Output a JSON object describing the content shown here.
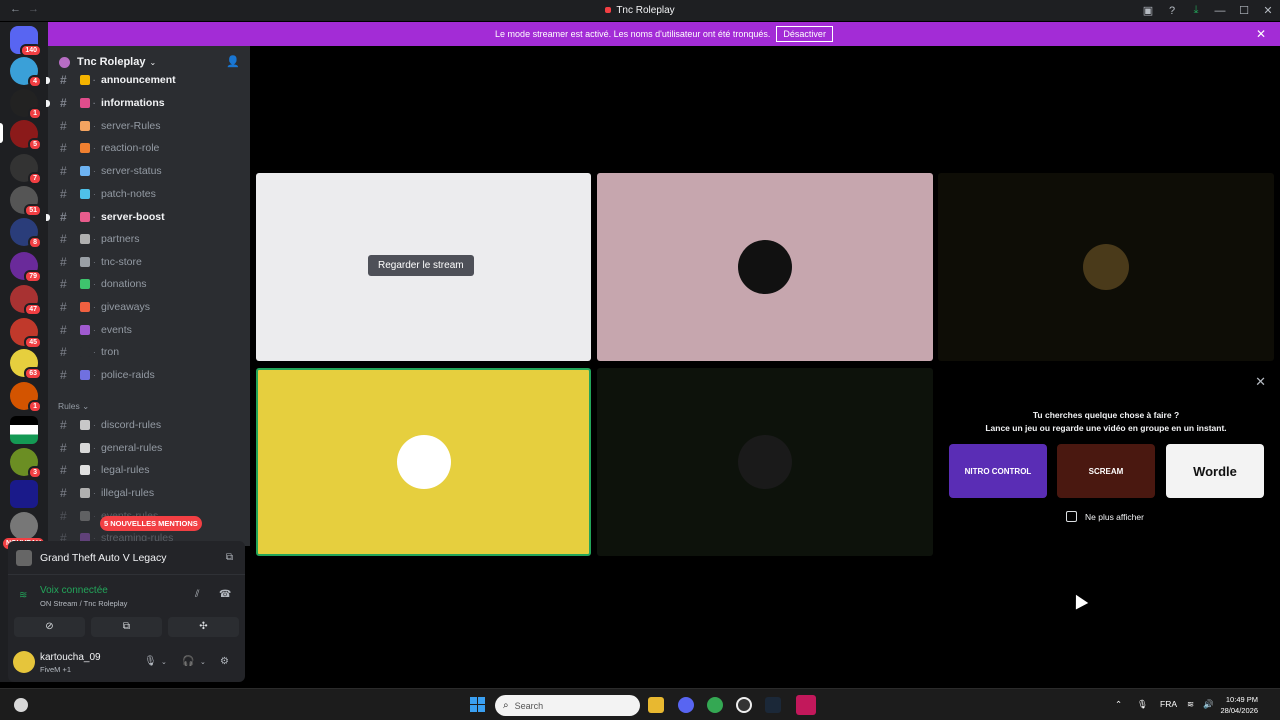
{
  "titlebar": {
    "title": "Tnc Roleplay",
    "back_icon": "←",
    "forward_icon": "→",
    "icons": [
      "inbox-icon",
      "help-icon",
      "download-icon",
      "minimize-icon",
      "maximize-icon",
      "close-icon"
    ]
  },
  "banner": {
    "text": "Le mode streamer est activé. Les noms d'utilisateur ont été tronqués.",
    "button": "Désactiver",
    "color": "#a32cd6"
  },
  "servers": {
    "badges": [
      "140",
      "4",
      "1",
      "5",
      "7",
      "51",
      "8",
      "79",
      "47",
      "45",
      "63",
      "1",
      "3",
      "",
      ""
    ],
    "new_label": "NOUVEAU"
  },
  "guild": {
    "name": "Tnc Roleplay",
    "channels": [
      {
        "name": "announcement",
        "emoji_color": "#f4b400",
        "bright": true
      },
      {
        "name": "informations",
        "emoji_color": "#e04d8c",
        "bright": true
      },
      {
        "name": "server-Rules",
        "emoji_color": "#f4a460",
        "bright": false
      },
      {
        "name": "reaction-role",
        "emoji_color": "#f08030",
        "bright": false
      },
      {
        "name": "server-status",
        "emoji_color": "#6db3f2",
        "bright": false
      },
      {
        "name": "patch-notes",
        "emoji_color": "#4fc1e9",
        "bright": false
      },
      {
        "name": "server-boost",
        "emoji_color": "#e85c8c",
        "bright": true
      },
      {
        "name": "partners",
        "emoji_color": "#b0b0b0",
        "bright": false
      },
      {
        "name": "tnc-store",
        "emoji_color": "#9aa0a6",
        "bright": false
      },
      {
        "name": "donations",
        "emoji_color": "#3ec46d",
        "bright": false
      },
      {
        "name": "giveaways",
        "emoji_color": "#f06040",
        "bright": false
      },
      {
        "name": "events",
        "emoji_color": "#a05ad0",
        "bright": false
      },
      {
        "name": "tron",
        "emoji_color": "#2b2d31",
        "bright": false
      },
      {
        "name": "police-raids",
        "emoji_color": "#7070e0",
        "bright": false
      }
    ],
    "category": "Rules",
    "rules_channels": [
      {
        "name": "discord-rules",
        "emoji_color": "#c8c8c8"
      },
      {
        "name": "general-rules",
        "emoji_color": "#d8d8d8"
      },
      {
        "name": "legal-rules",
        "emoji_color": "#e0e0e0"
      },
      {
        "name": "illegal-rules",
        "emoji_color": "#b0b0b0"
      },
      {
        "name": "events-rules",
        "emoji_color": "#a0a0a0"
      },
      {
        "name": "streaming-rules",
        "emoji_color": "#a05ad0"
      }
    ],
    "mentions_pill": "5 NOUVELLES MENTIONS"
  },
  "panel": {
    "game": "Grand Theft Auto V Legacy",
    "voice_status": "Voix connectée",
    "voice_sub": "ON Stream / Tnc Roleplay",
    "user_name": "kartoucha_09",
    "user_status": "FiveM +1"
  },
  "stage": {
    "watch_button": "Regarder le stream",
    "tiles": [
      {
        "bg": "#ececee"
      },
      {
        "bg": "#c6a6ae"
      },
      {
        "bg": "#0e0d06"
      },
      {
        "bg": "#e6cf3e"
      },
      {
        "bg": "#0d120b"
      }
    ]
  },
  "activity": {
    "line1": "Tu cherches quelque chose à faire ?",
    "line2": "Lance un jeu ou regarde une vidéo en groupe en un instant.",
    "games": [
      "NITRO CONTROL",
      "SCREAM",
      "Wordle"
    ],
    "checkbox_label": "Ne plus afficher"
  },
  "taskbar": {
    "search_placeholder": "Search",
    "lang": "FRA",
    "time": "10:49 PM",
    "date": "28/04/2026"
  }
}
